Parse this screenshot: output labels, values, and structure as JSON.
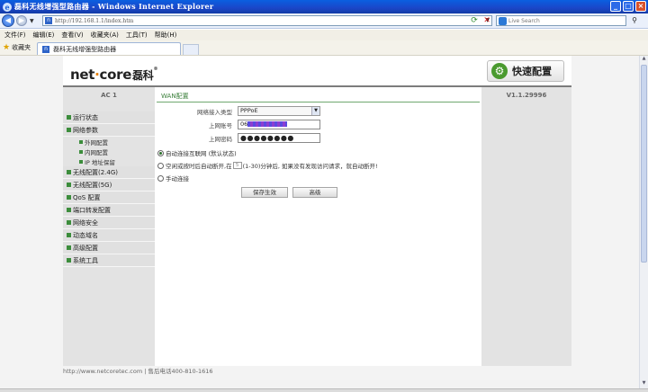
{
  "window": {
    "title": "磊科无线增强型路由器 - Windows Internet Explorer",
    "minimize": "_",
    "maximize": "□",
    "close": "×"
  },
  "address": {
    "url": "http://192.168.1.1/index.htm",
    "search_placeholder": "Live Search"
  },
  "menubar": [
    "文件(F)",
    "编辑(E)",
    "查看(V)",
    "收藏夹(A)",
    "工具(T)",
    "帮助(H)"
  ],
  "favorites": {
    "label": "收藏夹",
    "tab_title": "磊科无线增强型路由器"
  },
  "router": {
    "logo_text": "net",
    "logo_dot": "·",
    "logo_text2": "core",
    "logo_cn": "磊科",
    "logo_reg": "®",
    "quick_setup": "快速配置",
    "model": "AC 1",
    "version": "V1.1.29996"
  },
  "sidebar": {
    "items": [
      {
        "label": "运行状态"
      },
      {
        "label": "网络参数"
      }
    ],
    "sub_items": [
      "外网配置",
      "内网配置",
      "IP 地址保留"
    ],
    "items2": [
      {
        "label": "无线配置(2.4G)"
      },
      {
        "label": "无线配置(5G)"
      },
      {
        "label": "QoS 配置"
      },
      {
        "label": "端口转发配置"
      },
      {
        "label": "网络安全"
      },
      {
        "label": "动态域名"
      },
      {
        "label": "高级配置"
      },
      {
        "label": "系统工具"
      }
    ]
  },
  "wan": {
    "section_title": "WAN配置",
    "type_label": "网络接入类型",
    "type_value": "PPPoE",
    "account_label": "上网账号",
    "account_prefix": "06",
    "password_label": "上网密码",
    "password_value": "●●●●●●●●",
    "radio_auto": "自动连接互联网 (默认状态)",
    "radio_idle_pre": "空闲或按时后自动断开,在",
    "idle_value": "5",
    "radio_idle_post": "(1-30)分钟后, 如果没有发现访问请求，就自动断开!",
    "radio_manual": "手动连接",
    "save_button": "保存生效",
    "advanced_button": "高级"
  },
  "footer": "http://www.netcoretec.com | 售后电话400-810-1616"
}
